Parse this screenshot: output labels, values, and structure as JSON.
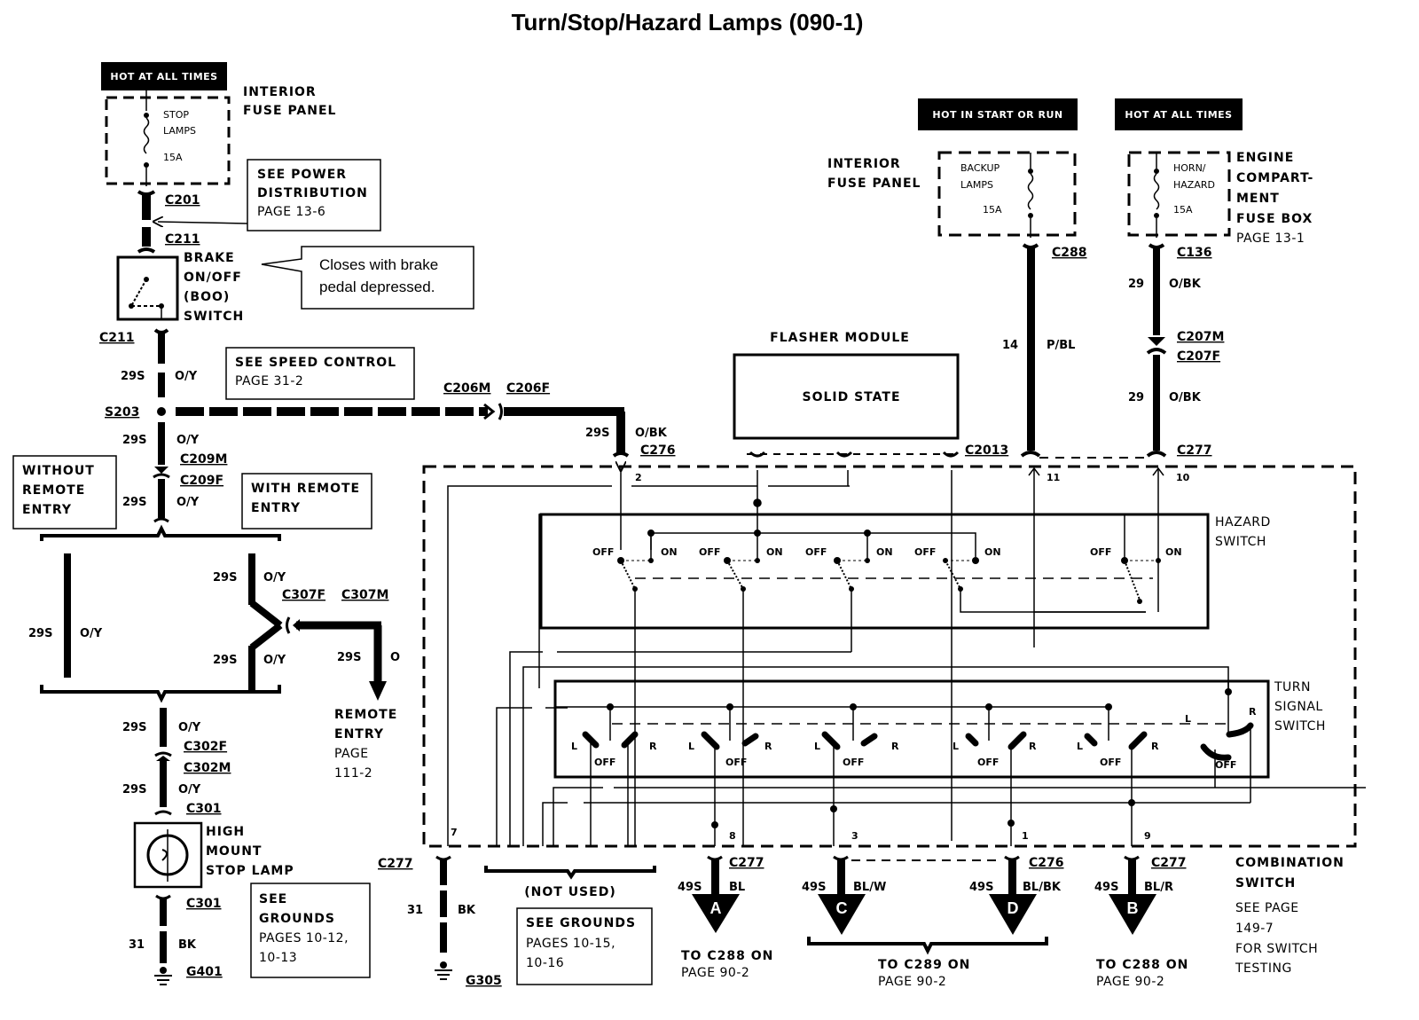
{
  "title": "Turn/Stop/Hazard Lamps (090-1)",
  "colors": {
    "ink": "#000000",
    "paper": "#ffffff"
  },
  "power_sources": {
    "left": {
      "label": "HOT AT ALL TIMES"
    },
    "middle": {
      "label": "HOT IN START OR RUN"
    },
    "right": {
      "label": "HOT AT ALL TIMES"
    }
  },
  "fuses": {
    "stop_lamps": {
      "name_line1": "STOP",
      "name_line2": "LAMPS",
      "rating": "15A",
      "panel_line1": "INTERIOR",
      "panel_line2": "FUSE PANEL"
    },
    "backup_lamps": {
      "name_line1": "BACKUP",
      "name_line2": "LAMPS",
      "rating": "15A",
      "panel_line1": "INTERIOR",
      "panel_line2": "FUSE PANEL"
    },
    "horn_hazard": {
      "name_line1": "HORN/",
      "name_line2": "HAZARD",
      "rating": "15A",
      "panel_line1": "ENGINE",
      "panel_line2": "COMPART-",
      "panel_line3": "MENT",
      "panel_line4": "FUSE BOX",
      "panel_page": "PAGE 13-1"
    }
  },
  "notes": {
    "power_distribution": {
      "line1": "SEE POWER",
      "line2": "DISTRIBUTION",
      "line3": "PAGE 13-6"
    },
    "boo_callout": {
      "line1": "Closes with brake",
      "line2": "pedal depressed."
    },
    "speed_control": {
      "line1": "SEE SPEED CONTROL",
      "line2": "PAGE 31-2"
    },
    "without_remote": {
      "line1": "WITHOUT",
      "line2": "REMOTE",
      "line3": "ENTRY"
    },
    "with_remote": {
      "line1": "WITH REMOTE",
      "line2": "ENTRY"
    },
    "remote_entry": {
      "line1": "REMOTE",
      "line2": "ENTRY",
      "line3": "PAGE",
      "line4": "111-2"
    },
    "grounds_left": {
      "line1": "SEE",
      "line2": "GROUNDS",
      "line3": "PAGES 10-12,",
      "line4": "10-13"
    },
    "grounds_mid": {
      "line1": "SEE GROUNDS",
      "line2": "PAGES 10-15,",
      "line3": "10-16"
    },
    "not_used": "(NOT USED)",
    "combination_switch": {
      "line1": "COMBINATION",
      "line2": "SWITCH",
      "line3": "SEE PAGE",
      "line4": "149-7",
      "line5": "FOR SWITCH",
      "line6": "TESTING"
    }
  },
  "components": {
    "boo_switch": {
      "line1": "BRAKE",
      "line2": "ON/OFF",
      "line3": "(BOO)",
      "line4": "SWITCH"
    },
    "high_mount": {
      "line1": "HIGH",
      "line2": "MOUNT",
      "line3": "STOP LAMP"
    },
    "flasher": {
      "label": "FLASHER MODULE",
      "inner": "SOLID STATE"
    },
    "hazard_switch": {
      "line1": "HAZARD",
      "line2": "SWITCH"
    },
    "turn_switch": {
      "line1": "TURN",
      "line2": "SIGNAL",
      "line3": "SWITCH"
    }
  },
  "connectors": {
    "c201": "C201",
    "c211a": "C211",
    "c211b": "C211",
    "s203": "S203",
    "c209m": "C209M",
    "c209f": "C209F",
    "c206m": "C206M",
    "c206f": "C206F",
    "c276_top": "C276",
    "c307f": "C307F",
    "c307m": "C307M",
    "c302f": "C302F",
    "c302m": "C302M",
    "c301a": "C301",
    "c301b": "C301",
    "g401": "G401",
    "c288_top": "C288",
    "c136": "C136",
    "c207m": "C207M",
    "c207f": "C207F",
    "c2013": "C2013",
    "c277_top": "C277",
    "c277_g": "C277",
    "g305": "G305",
    "c277_a": "C277",
    "c276_d": "C276",
    "c277_b": "C277"
  },
  "switch_labels": {
    "off": "OFF",
    "on": "ON",
    "l": "L",
    "r": "R"
  },
  "wires": {
    "w1": {
      "circuit": "29S",
      "color": "O/Y"
    },
    "w2": {
      "circuit": "29S",
      "color": "O/Y"
    },
    "w3": {
      "circuit": "29S",
      "color": "O/Y"
    },
    "wnr": {
      "circuit": "29S",
      "color": "O/Y"
    },
    "wr1": {
      "circuit": "29S",
      "color": "O/Y"
    },
    "wr2": {
      "circuit": "29S",
      "color": "O/Y"
    },
    "wremote": {
      "circuit": "29S",
      "color": "O"
    },
    "w4": {
      "circuit": "29S",
      "color": "O/Y"
    },
    "w5": {
      "circuit": "29S",
      "color": "O/Y"
    },
    "wg1": {
      "circuit": "31",
      "color": "BK"
    },
    "w276": {
      "circuit": "29S",
      "color": "O/BK"
    },
    "w288": {
      "circuit": "14",
      "color": "P/BL"
    },
    "w136": {
      "circuit": "29",
      "color": "O/BK"
    },
    "w207": {
      "circuit": "29",
      "color": "O/BK"
    },
    "wg2": {
      "circuit": "31",
      "color": "BK"
    },
    "wa": {
      "circuit": "49S",
      "color": "BL"
    },
    "wc": {
      "circuit": "49S",
      "color": "BL/W"
    },
    "wd": {
      "circuit": "49S",
      "color": "BL/BK"
    },
    "wb": {
      "circuit": "49S",
      "color": "BL/R"
    }
  },
  "pins": {
    "p2": "2",
    "p11": "11",
    "p10": "10",
    "p7": "7",
    "p8": "8",
    "p3": "3",
    "p1": "1",
    "p9": "9"
  },
  "outputs": {
    "a": {
      "letter": "A",
      "line1": "TO C288 ON",
      "line2": "PAGE 90-2"
    },
    "c": {
      "letter": "C"
    },
    "d": {
      "letter": "D"
    },
    "cd": {
      "line1": "TO C289 ON",
      "line2": "PAGE 90-2"
    },
    "b": {
      "letter": "B",
      "line1": "TO C288 ON",
      "line2": "PAGE 90-2"
    }
  }
}
